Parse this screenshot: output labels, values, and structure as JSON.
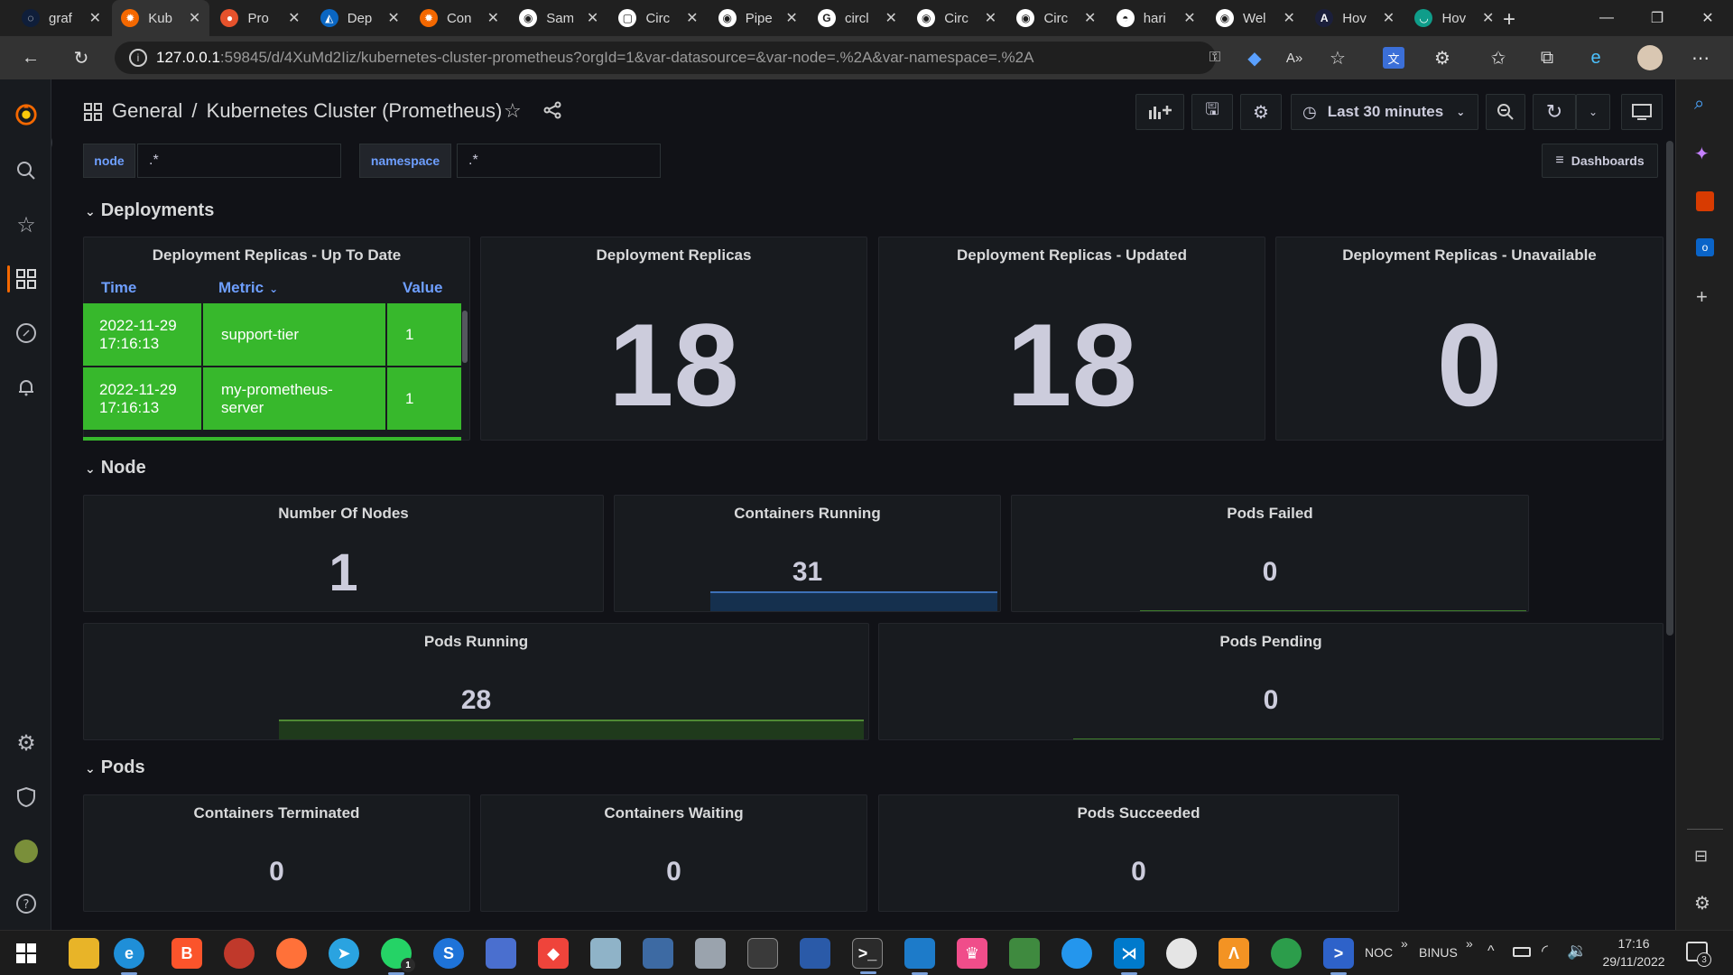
{
  "browser": {
    "tabs": [
      {
        "title": "graf",
        "color": "#0f1e3a",
        "glyph": "◌"
      },
      {
        "title": "Kub",
        "color": "#f46800",
        "glyph": "✹",
        "active": true
      },
      {
        "title": "Pro",
        "color": "#e6522c",
        "glyph": "●"
      },
      {
        "title": "Dep",
        "color": "#0a66c2",
        "glyph": "◭"
      },
      {
        "title": "Con",
        "color": "#f46800",
        "glyph": "✹"
      },
      {
        "title": "Sam",
        "color": "#ffffff",
        "glyph": "◉"
      },
      {
        "title": "Circ",
        "color": "#ffffff",
        "glyph": "▢"
      },
      {
        "title": "Pipe",
        "color": "#ffffff",
        "glyph": "◉"
      },
      {
        "title": "circl",
        "color": "#ffffff",
        "glyph": "G"
      },
      {
        "title": "Circ",
        "color": "#ffffff",
        "glyph": "◉"
      },
      {
        "title": "Circ",
        "color": "#ffffff",
        "glyph": "◉"
      },
      {
        "title": "hari",
        "color": "#ffffff",
        "glyph": "◓"
      },
      {
        "title": "Wel",
        "color": "#ffffff",
        "glyph": "◉"
      },
      {
        "title": "Hov",
        "color": "#1b1f3b",
        "glyph": "A"
      },
      {
        "title": "Hov",
        "color": "#0f9d8a",
        "glyph": "◡"
      }
    ],
    "url_host": "127.0.0.1",
    "url_rest": ":59845/d/4XuMd2Iiz/kubernetes-cluster-prometheus?orgId=1&var-datasource=&var-node=.%2A&var-namespace=.%2A"
  },
  "dashboard": {
    "breadcrumb_folder": "General",
    "breadcrumb_sep": "/",
    "title": "Kubernetes Cluster (Prometheus)",
    "time_range": "Last 30 minutes",
    "dashboards_button": "Dashboards",
    "variables": [
      {
        "label": "node",
        "value": ".*"
      },
      {
        "label": "namespace",
        "value": ".*"
      }
    ],
    "rows": {
      "deployments": "Deployments",
      "node": "Node",
      "pods": "Pods"
    },
    "table_panel": {
      "title": "Deployment Replicas - Up To Date",
      "columns": [
        "Time",
        "Metric",
        "Value"
      ],
      "rows": [
        {
          "time": "2022-11-29 17:16:13",
          "metric": "support-tier",
          "value": "1"
        },
        {
          "time": "2022-11-29 17:16:13",
          "metric": "my-prometheus-server",
          "value": "1"
        }
      ],
      "cell_color": "#37b82c"
    },
    "stats": {
      "deployment_replicas": {
        "title": "Deployment Replicas",
        "value": "18"
      },
      "deployment_replicas_updated": {
        "title": "Deployment Replicas - Updated",
        "value": "18"
      },
      "deployment_replicas_unavailable": {
        "title": "Deployment Replicas - Unavailable",
        "value": "0"
      },
      "number_of_nodes": {
        "title": "Number Of Nodes",
        "value": "1"
      },
      "containers_running": {
        "title": "Containers Running",
        "value": "31"
      },
      "pods_failed": {
        "title": "Pods Failed",
        "value": "0"
      },
      "pods_running": {
        "title": "Pods Running",
        "value": "28"
      },
      "pods_pending": {
        "title": "Pods Pending",
        "value": "0"
      },
      "containers_terminated": {
        "title": "Containers Terminated",
        "value": "0"
      },
      "containers_waiting": {
        "title": "Containers Waiting",
        "value": "0"
      },
      "pods_succeeded": {
        "title": "Pods Succeeded",
        "value": "0"
      }
    },
    "colors": {
      "accent": "#6e9fff",
      "green_spark": "#73bf69",
      "blue_spark": "#5794f2"
    }
  },
  "taskbar": {
    "tray_labels": [
      "NOC",
      "BINUS"
    ],
    "time": "17:16",
    "date": "29/11/2022",
    "notifications": "3",
    "whatsapp_badge": "1"
  }
}
